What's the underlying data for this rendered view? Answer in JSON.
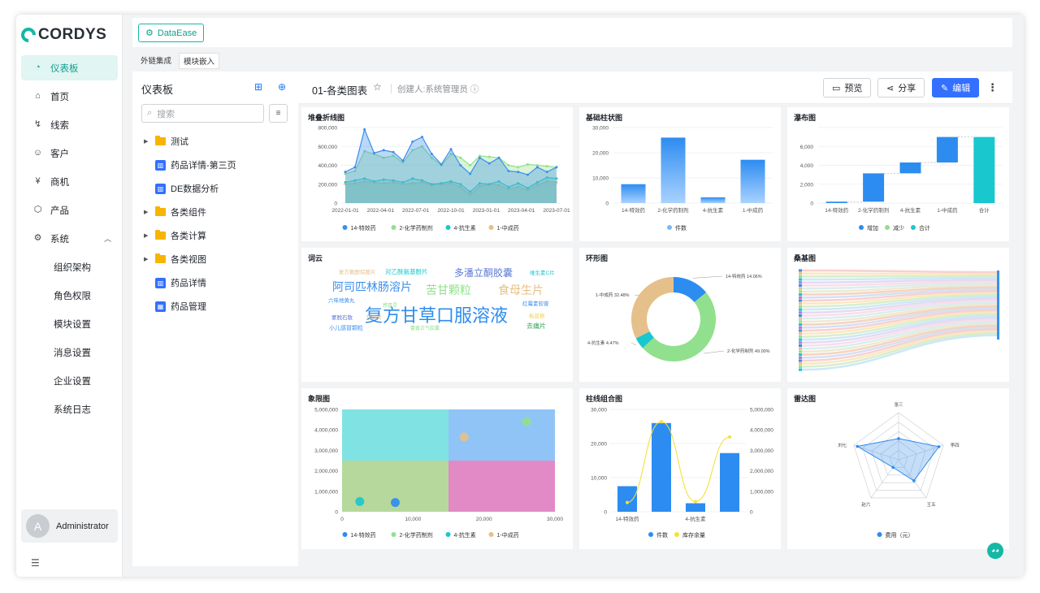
{
  "app": {
    "logo_text": "CORDYS",
    "top_button": "DataEase"
  },
  "nav": {
    "items": [
      {
        "label": "仪表板",
        "icon": "dashboard-icon",
        "active": true
      },
      {
        "label": "首页",
        "icon": "home-icon"
      },
      {
        "label": "线索",
        "icon": "lead-icon"
      },
      {
        "label": "客户",
        "icon": "customer-icon"
      },
      {
        "label": "商机",
        "icon": "opportunity-icon"
      },
      {
        "label": "产品",
        "icon": "product-icon"
      },
      {
        "label": "系统",
        "icon": "gear-icon"
      },
      {
        "label": "组织架构"
      },
      {
        "label": "角色权限"
      },
      {
        "label": "模块设置"
      },
      {
        "label": "消息设置"
      },
      {
        "label": "企业设置"
      },
      {
        "label": "系统日志"
      }
    ],
    "user": {
      "initial": "A",
      "name": "Administrator"
    }
  },
  "tabs": [
    "外链集成",
    "模块嵌入"
  ],
  "tree": {
    "title": "仪表板",
    "search_placeholder": "搜索",
    "items": [
      {
        "label": "测试",
        "type": "folder"
      },
      {
        "label": "药品详情-第三页",
        "type": "dashboard"
      },
      {
        "label": "DE数据分析",
        "type": "dashboard"
      },
      {
        "label": "各类组件",
        "type": "folder"
      },
      {
        "label": "各类计算",
        "type": "folder"
      },
      {
        "label": "各类视图",
        "type": "folder"
      },
      {
        "label": "药品详情",
        "type": "dashboard"
      },
      {
        "label": "药品管理",
        "type": "dashboard"
      }
    ]
  },
  "header": {
    "title": "01-各类图表",
    "creator": "创建人:系统管理员",
    "preview": "预览",
    "share": "分享",
    "edit": "编辑"
  },
  "cards": {
    "c1": "堆叠折线图",
    "c2": "基础柱状图",
    "c3": "瀑布图",
    "c4": "词云",
    "c5": "环形图",
    "c6": "桑基图",
    "c7": "象限图",
    "c8": "柱线组合图",
    "c9": "雷达图"
  },
  "colors": {
    "blue": "#3b8fec",
    "green": "#91e08d",
    "cyan": "#19c7cf",
    "tan": "#e5c08a",
    "accent": "#14b8a6"
  },
  "chart_data": [
    {
      "type": "area",
      "title": "堆叠折线图",
      "x_ticks": [
        "2022-01-01",
        "2022-04-01",
        "2022-07-01",
        "2022-10-01",
        "2023-01-01",
        "2023-04-01",
        "2023-07-01"
      ],
      "y_ticks": [
        "0",
        "200,000",
        "400,000",
        "600,000",
        "800,000"
      ],
      "ylim": [
        0,
        800000
      ],
      "series": [
        {
          "name": "14-特效药",
          "values": [
            330000,
            380000,
            780000,
            530000,
            560000,
            540000,
            450000,
            650000,
            700000,
            520000,
            410000,
            570000,
            400000,
            310000,
            480000,
            420000,
            480000,
            340000,
            330000,
            300000,
            380000,
            330000,
            380000
          ]
        },
        {
          "name": "2-化学药制剂",
          "values": [
            310000,
            340000,
            550000,
            520000,
            480000,
            500000,
            430000,
            560000,
            600000,
            480000,
            400000,
            520000,
            480000,
            400000,
            500000,
            490000,
            480000,
            400000,
            380000,
            410000,
            400000,
            390000,
            380000
          ]
        },
        {
          "name": "4-抗生素",
          "values": [
            220000,
            240000,
            260000,
            230000,
            250000,
            240000,
            220000,
            260000,
            240000,
            200000,
            210000,
            230000,
            200000,
            120000,
            210000,
            200000,
            230000,
            170000,
            210000,
            160000,
            220000,
            270000,
            260000
          ]
        },
        {
          "name": "1-中成药",
          "values": [
            200000,
            210000,
            230000,
            220000,
            210000,
            220000,
            200000,
            210000,
            220000,
            190000,
            200000,
            210000,
            170000,
            90000,
            180000,
            200000,
            190000,
            150000,
            170000,
            140000,
            190000,
            230000,
            220000
          ]
        }
      ]
    },
    {
      "type": "bar",
      "title": "基础柱状图",
      "categories": [
        "14-特效药",
        "2-化学药制剂",
        "4-抗生素",
        "1-中成药"
      ],
      "series": [
        {
          "name": "件数",
          "values": [
            7500,
            26000,
            2300,
            17200
          ]
        }
      ],
      "y_ticks": [
        "0",
        "10,000",
        "20,000",
        "30,000"
      ],
      "ylim": [
        0,
        30000
      ]
    },
    {
      "type": "bar",
      "title": "瀑布图",
      "categories": [
        "14-特效药",
        "2-化学药制剂",
        "4-抗生素",
        "1-中成药",
        "合计"
      ],
      "steps": [
        150,
        3000,
        1150,
        2700,
        7000
      ],
      "legend": [
        "增加",
        "减少",
        "合计"
      ],
      "y_ticks": [
        "0",
        "2,000",
        "4,000",
        "6,000"
      ],
      "ylim": [
        0,
        8000
      ]
    },
    {
      "type": "other",
      "title": "词云",
      "words": [
        "复方甘草口服溶液",
        "阿司匹林肠溶片",
        "多潘立酮胶囊",
        "苦甘颗粒",
        "食母生片",
        "对乙酰氨基酚片",
        "复方氨酚烷胺片",
        "六味地黄丸",
        "蒙脱石散",
        "小儿感冒颗粒",
        "维生素C片",
        "去痛片",
        "藿香正气胶囊",
        "红霉素软膏",
        "板蓝根",
        "银翘片",
        "感冒灵"
      ]
    },
    {
      "type": "pie",
      "title": "环形图",
      "slices": [
        {
          "name": "14-特效药",
          "value": 14.06,
          "label": "14-特效药 14.06%"
        },
        {
          "name": "2-化学药制剂",
          "value": 49.0,
          "label": "2-化学药制剂 49.00%"
        },
        {
          "name": "4-抗生素",
          "value": 4.47,
          "label": "4-抗生素 4.47%"
        },
        {
          "name": "1-中成药",
          "value": 32.48,
          "label": "1-中成药 32.48%"
        }
      ]
    },
    {
      "type": "other",
      "title": "桑基图"
    },
    {
      "type": "scatter",
      "title": "象限图",
      "x_ticks": [
        "0",
        "10,000",
        "20,000",
        "30,000"
      ],
      "y_ticks": [
        "0",
        "1,000,000",
        "2,000,000",
        "3,000,000",
        "4,000,000",
        "5,000,000"
      ],
      "xlim": [
        0,
        30000
      ],
      "ylim": [
        0,
        5000000
      ],
      "points": [
        {
          "name": "14-特效药",
          "x": 7500,
          "y": 450000
        },
        {
          "name": "2-化学药制剂",
          "x": 26000,
          "y": 4400000
        },
        {
          "name": "4-抗生素",
          "x": 2500,
          "y": 500000
        },
        {
          "name": "1-中成药",
          "x": 17200,
          "y": 3650000
        }
      ]
    },
    {
      "type": "bar",
      "title": "柱线组合图",
      "categories": [
        "14-特效药",
        "2-化学药制剂",
        "4-抗生素",
        "1-中成药"
      ],
      "x_ticks": [
        "14-特效药",
        "4-抗生素"
      ],
      "series": [
        {
          "name": "件数",
          "values": [
            7500,
            26000,
            2500,
            17200
          ]
        },
        {
          "name": "库存余量",
          "values": [
            450000,
            4400000,
            500000,
            3650000
          ]
        }
      ],
      "y_ticks": [
        "0",
        "10,000",
        "20,000",
        "30,000"
      ],
      "y2_ticks": [
        "0",
        "1,000,000",
        "2,000,000",
        "3,000,000",
        "4,000,000",
        "5,000,000"
      ],
      "ylim": [
        0,
        30000
      ],
      "y2lim": [
        0,
        5000000
      ]
    },
    {
      "type": "other",
      "title": "雷达图",
      "indicators": [
        "张三",
        "李四",
        "王五",
        "赵六",
        "刘七"
      ],
      "series": [
        {
          "name": "费用（元）",
          "values": [
            0.45,
            0.9,
            0.55,
            0.2,
            0.92
          ]
        }
      ]
    }
  ]
}
